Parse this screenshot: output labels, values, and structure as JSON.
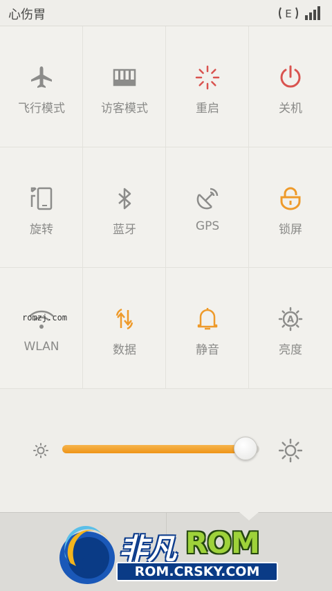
{
  "status_bar": {
    "carrier": "心伤胃",
    "network_icon": "network-e-icon",
    "signal_icon": "signal-bars-icon"
  },
  "toggles": [
    {
      "label": "飞行模式",
      "icon": "airplane-icon",
      "color": "#8c8c8a"
    },
    {
      "label": "访客模式",
      "icon": "guest-mode-icon",
      "color": "#8c8c8a"
    },
    {
      "label": "重启",
      "icon": "reboot-icon",
      "color": "#d9534f"
    },
    {
      "label": "关机",
      "icon": "power-icon",
      "color": "#d9534f"
    },
    {
      "label": "旋转",
      "icon": "rotate-icon",
      "color": "#8c8c8a"
    },
    {
      "label": "蓝牙",
      "icon": "bluetooth-icon",
      "color": "#8c8c8a"
    },
    {
      "label": "GPS",
      "icon": "gps-icon",
      "color": "#8c8c8a"
    },
    {
      "label": "锁屏",
      "icon": "lock-icon",
      "color": "#ee9a2a"
    },
    {
      "label": "WLAN",
      "icon": "wifi-icon",
      "color": "#8c8c8a"
    },
    {
      "label": "数据",
      "icon": "data-icon",
      "color": "#ee9a2a"
    },
    {
      "label": "静音",
      "icon": "bell-icon",
      "color": "#ee9a2a"
    },
    {
      "label": "亮度",
      "icon": "auto-brightness-icon",
      "color": "#8c8c8a"
    }
  ],
  "brightness": {
    "level": 0.93,
    "accent": "#ee9a2a"
  },
  "overlay_text": "romzj.com",
  "watermark": {
    "title_part1": "非凡",
    "title_part2": "ROM",
    "url": "ROM.CRSKY.COM"
  }
}
